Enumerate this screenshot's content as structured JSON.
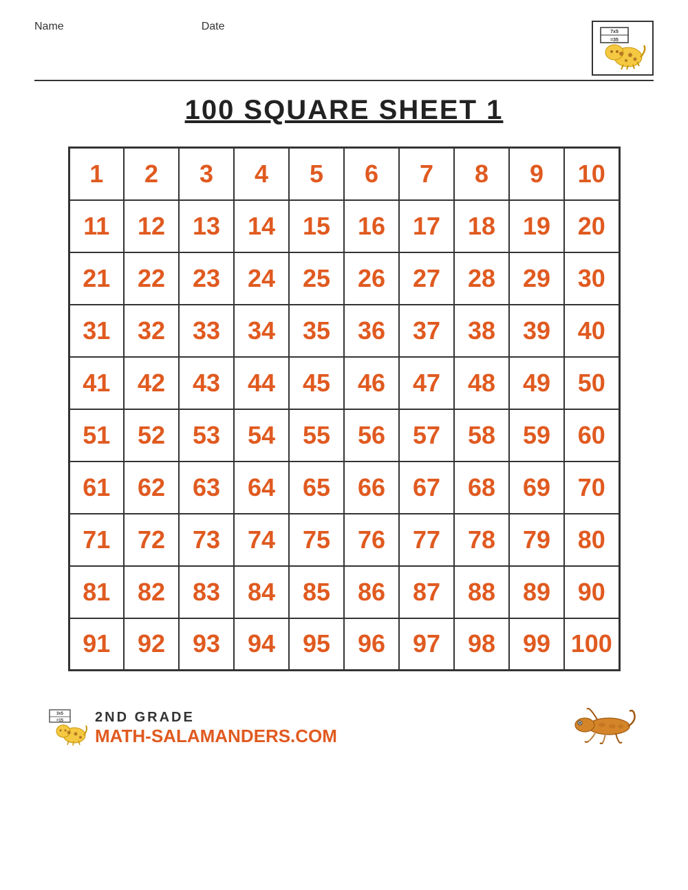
{
  "header": {
    "name_label": "Name",
    "date_label": "Date"
  },
  "title": "100 SQUARE SHEET 1",
  "grid": {
    "numbers": [
      [
        1,
        2,
        3,
        4,
        5,
        6,
        7,
        8,
        9,
        10
      ],
      [
        11,
        12,
        13,
        14,
        15,
        16,
        17,
        18,
        19,
        20
      ],
      [
        21,
        22,
        23,
        24,
        25,
        26,
        27,
        28,
        29,
        30
      ],
      [
        31,
        32,
        33,
        34,
        35,
        36,
        37,
        38,
        39,
        40
      ],
      [
        41,
        42,
        43,
        44,
        45,
        46,
        47,
        48,
        49,
        50
      ],
      [
        51,
        52,
        53,
        54,
        55,
        56,
        57,
        58,
        59,
        60
      ],
      [
        61,
        62,
        63,
        64,
        65,
        66,
        67,
        68,
        69,
        70
      ],
      [
        71,
        72,
        73,
        74,
        75,
        76,
        77,
        78,
        79,
        80
      ],
      [
        81,
        82,
        83,
        84,
        85,
        86,
        87,
        88,
        89,
        90
      ],
      [
        91,
        92,
        93,
        94,
        95,
        96,
        97,
        98,
        99,
        100
      ]
    ]
  },
  "footer": {
    "grade": "2ND GRADE",
    "site_prefix": "M",
    "site_name": "ATH-SALAMANDERS.COM"
  }
}
